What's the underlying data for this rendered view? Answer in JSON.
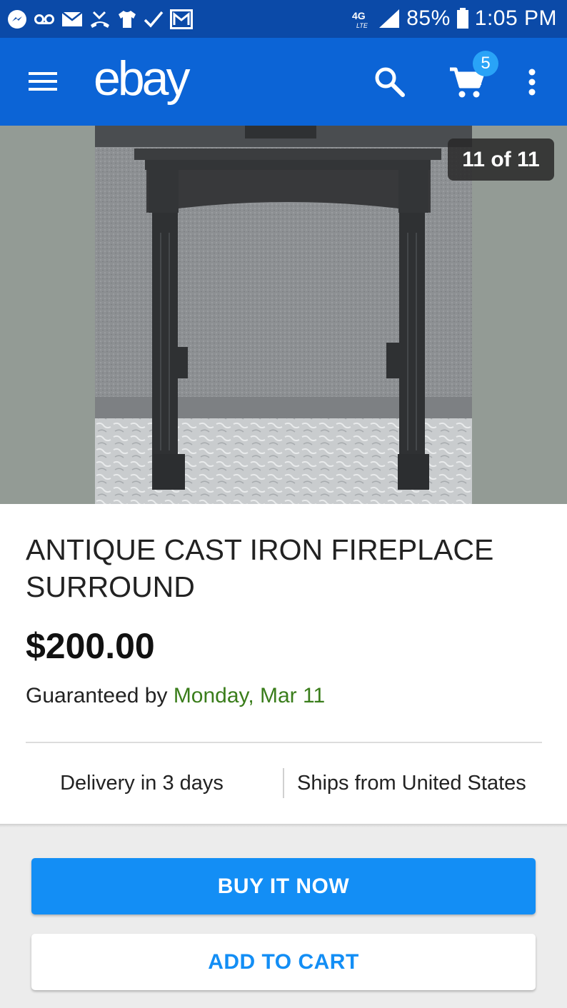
{
  "status_bar": {
    "network": "4G LTE",
    "battery": "85%",
    "time": "1:05 PM",
    "left_icons": [
      "messenger-icon",
      "voicemail-icon",
      "mail-icon",
      "missed-call-icon",
      "shirt-icon",
      "check-icon",
      "gmail-icon"
    ],
    "right_icons": [
      "network-4g-icon",
      "signal-icon",
      "battery-icon"
    ]
  },
  "app_bar": {
    "logo": "ebay",
    "cart_count": "5",
    "icons": [
      "menu-icon",
      "search-icon",
      "cart-icon",
      "more-vert-icon"
    ]
  },
  "gallery": {
    "counter": "11 of 11"
  },
  "listing": {
    "title": "ANTIQUE CAST IRON FIREPLACE SURROUND",
    "price": "$200.00",
    "guarantee_prefix": "Guaranteed by ",
    "guarantee_date": "Monday, Mar 11",
    "delivery": "Delivery in 3 days",
    "ships_from": "Ships from United States"
  },
  "actions": {
    "buy_now": "BUY IT NOW",
    "add_to_cart": "ADD TO CART"
  },
  "colors": {
    "status_bar": "#0b4aa8",
    "app_bar": "#0c64d6",
    "primary_button": "#138ef5",
    "guarantee_date": "#3a7d1b"
  }
}
